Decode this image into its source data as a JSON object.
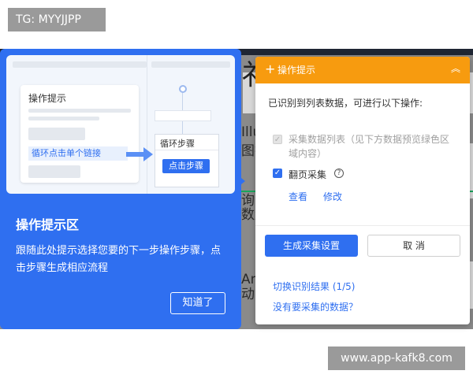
{
  "watermarks": {
    "top": "TG: MYYJJPP",
    "bottom": "www.app-kafk8.com"
  },
  "background": {
    "fragments": [
      "Illu",
      "图抖",
      "询",
      "数量",
      "Am",
      "动i"
    ],
    "big_glyph": "礻"
  },
  "guide": {
    "illustration": {
      "card_title": "操作提示",
      "loop_link": "循环点击单个链接",
      "loop_title": "循环步骤",
      "step_button": "点击步骤"
    },
    "title": "操作提示区",
    "description": "跟随此处提示选择您要的下一步操作步骤，点击步骤生成相应流程",
    "got_it": "知道了"
  },
  "popup": {
    "title": "操作提示",
    "recognized": "已识别到列表数据，可进行以下操作:",
    "option_list": "采集数据列表（见下方数据预览绿色区域内容）",
    "option_paging": "翻页采集",
    "view": "查看",
    "edit": "修改",
    "generate_button": "生成采集设置",
    "cancel_button": "取 消",
    "switch_result": "切换识别结果 (1/5)",
    "no_data": "没有要采集的数据？"
  },
  "colors": {
    "accent_blue": "#2f6ff0",
    "header_orange": "#f79b0f"
  }
}
